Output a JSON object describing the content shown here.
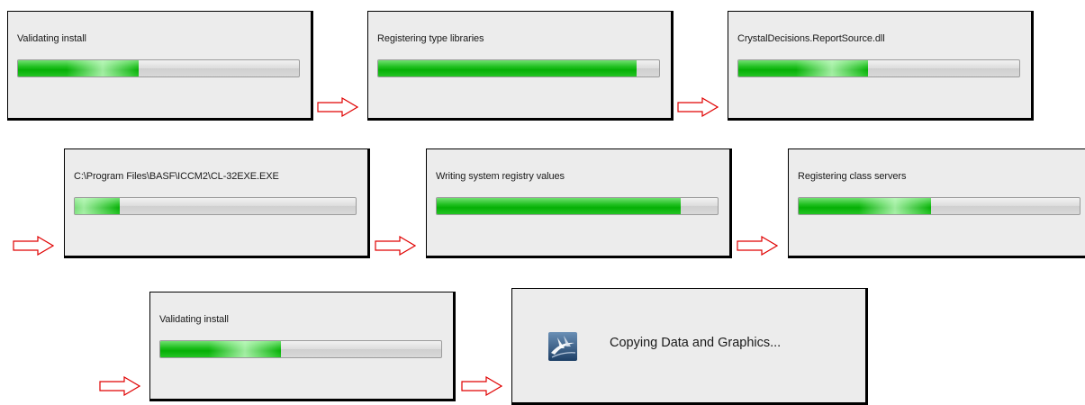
{
  "colors": {
    "panel_background": "#ececec",
    "panel_border": "#000000",
    "progress_green": "#16bb16",
    "progress_track": "#d8d8d8",
    "arrow_stroke": "#e00000"
  },
  "dialogs": [
    {
      "status": "Validating install",
      "progress": 0.43
    },
    {
      "status": "Registering type libraries",
      "progress": 0.92
    },
    {
      "status": "CrystalDecisions.ReportSource.dll",
      "progress": 0.46
    },
    {
      "status": "C:\\Program Files\\BASF\\ICCM2\\CL-32EXE.EXE",
      "progress": 0.16
    },
    {
      "status": "Writing system registry values",
      "progress": 0.87
    },
    {
      "status": "Registering class servers",
      "progress": 0.47
    },
    {
      "status": "Validating install",
      "progress": 0.43
    }
  ],
  "final_dialog": {
    "message": "Copying Data and Graphics...",
    "icon": "basf-setup-logo-icon"
  },
  "arrow_icon": "right-arrow-icon"
}
